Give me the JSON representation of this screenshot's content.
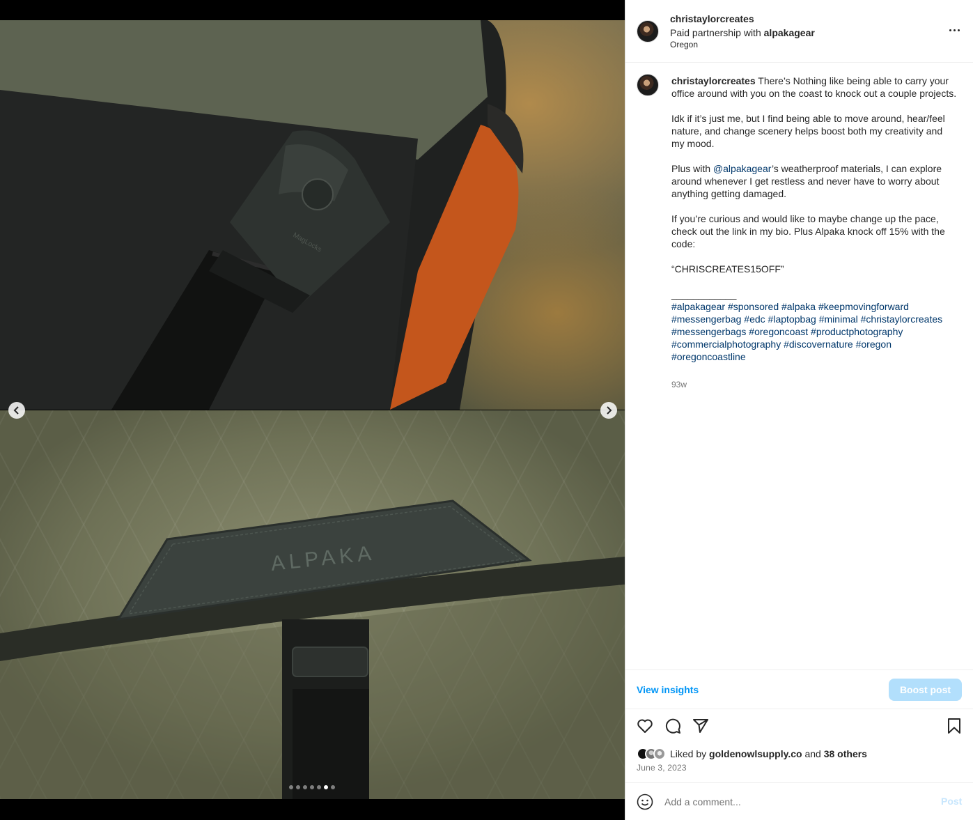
{
  "post": {
    "username": "christaylorcreates",
    "partnership_prefix": "Paid partnership with ",
    "partner": "alpakagear",
    "location": "Oregon"
  },
  "caption": {
    "username": "christaylorcreates",
    "p1": " There’s Nothing like being able to carry your office around with you on the coast to knock out a couple projects.\n\nIdk if it’s just me, but I find being able to move around, hear/feel nature, and change scenery helps boost both my creativity and my mood.\n\nPlus with ",
    "mention": "@alpakagear",
    "p2": "’s weatherproof materials, I can explore around whenever I get restless and never have to worry about anything getting damaged.\n\nIf you’re curious and would like to maybe change up the pace, check out the link in my bio. Plus Alpaka knock off 15% with the code:\n\n“CHRISCREATES15OFF”\n\n____________\n",
    "hashtags": [
      "#alpakagear",
      "#sponsored",
      "#alpaka",
      "#keepmovingforward",
      "#messengerbag",
      "#edc",
      "#laptopbag",
      "#minimal",
      "#christaylorcreates",
      "#messengerbags",
      "#oregoncoast",
      "#productphotography",
      "#commercialphotography",
      "#discovernature",
      "#oregon",
      "#oregoncoastline"
    ],
    "time_ago": "93w"
  },
  "insights": {
    "view_label": "View insights",
    "boost_label": "Boost post"
  },
  "likes": {
    "prefix": "Liked by ",
    "user": "goldenowlsupply.co",
    "middle": " and ",
    "others": "38 others"
  },
  "date": "June 3, 2023",
  "comment": {
    "placeholder": "Add a comment...",
    "post_label": "Post"
  },
  "carousel": {
    "total": 7,
    "active_index": 5
  },
  "media": {
    "top_alt": "Close-up of messenger bag buckle on rocks",
    "bottom_alt": "ALPAKA leather patch on bag flap",
    "brand_mark": "ALPAKA",
    "buckle_mark": "MagLocks"
  },
  "icons": {
    "header_more": "more-horizontal-icon",
    "like": "heart-icon",
    "comment": "comment-icon",
    "share": "share-icon",
    "save": "bookmark-icon",
    "emoji": "emoji-icon",
    "prev": "chevron-left-icon",
    "next": "chevron-right-icon"
  },
  "colors": {
    "link": "#00376b",
    "accent": "#0095f6",
    "boost_bg": "#b2dffc"
  }
}
